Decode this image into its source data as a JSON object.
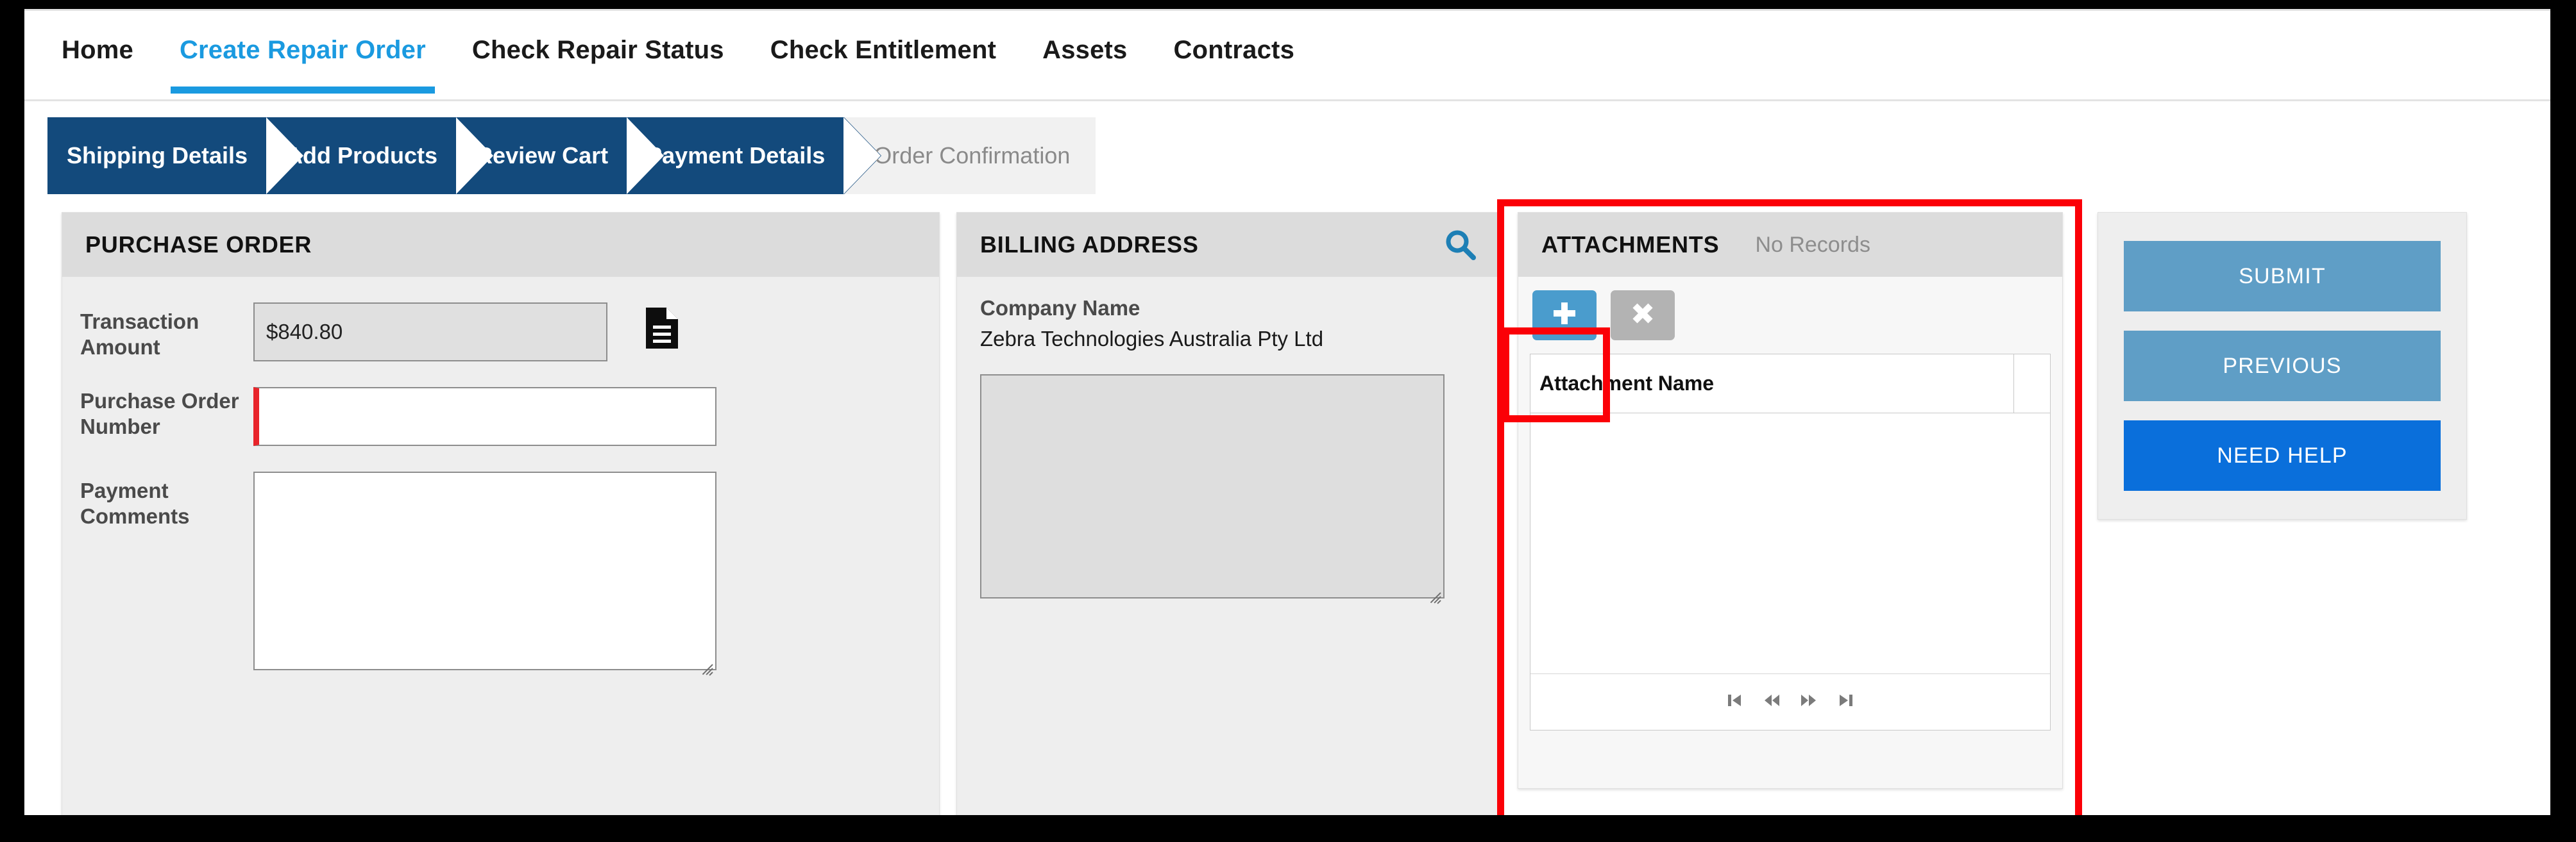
{
  "nav": {
    "items": [
      {
        "label": "Home",
        "active": false
      },
      {
        "label": "Create Repair Order",
        "active": true
      },
      {
        "label": "Check Repair Status",
        "active": false
      },
      {
        "label": "Check Entitlement",
        "active": false
      },
      {
        "label": "Assets",
        "active": false
      },
      {
        "label": "Contracts",
        "active": false
      }
    ]
  },
  "steps": [
    {
      "label": "Shipping Details",
      "state": "done"
    },
    {
      "label": "Add Products",
      "state": "done"
    },
    {
      "label": "Review Cart",
      "state": "done"
    },
    {
      "label": "Payment Details",
      "state": "current"
    },
    {
      "label": "Order Confirmation",
      "state": "upcoming"
    }
  ],
  "purchase_order": {
    "title": "PURCHASE ORDER",
    "transaction_amount_label": "Transaction Amount",
    "transaction_amount_value": "$840.80",
    "document_icon": "document-icon",
    "po_number_label": "Purchase Order Number",
    "po_number_value": "",
    "po_number_placeholder": "",
    "payment_comments_label": "Payment Comments",
    "payment_comments_value": "",
    "payment_comments_placeholder": ""
  },
  "billing_address": {
    "title": "BILLING ADDRESS",
    "search_icon": "search-icon",
    "company_name_label": "Company Name",
    "company_name_value": "Zebra Technologies Australia Pty Ltd",
    "address_value": "",
    "address_placeholder": ""
  },
  "attachments": {
    "title": "ATTACHMENTS",
    "status": "No Records",
    "add_icon": "plus-icon",
    "delete_icon": "close-icon",
    "columns": [
      "Attachment Name"
    ],
    "rows": [],
    "pager": [
      {
        "name": "first-page-button",
        "glyph": "⏮"
      },
      {
        "name": "previous-page-button",
        "glyph": "⏪"
      },
      {
        "name": "next-page-button",
        "glyph": "⏩"
      },
      {
        "name": "last-page-button",
        "glyph": "⏭"
      }
    ]
  },
  "actions": {
    "submit_label": "SUBMIT",
    "previous_label": "PREVIOUS",
    "need_help_label": "NEED HELP"
  },
  "colors": {
    "accent_blue": "#1a9ae0",
    "step_blue": "#134a7c",
    "button_light_blue": "#5f9ec6",
    "button_strong_blue": "#0a6fdb",
    "add_button_blue": "#4a9ccd",
    "required_red": "#e8242a",
    "annotation_red": "#fb0007",
    "panel_grey": "#eeeeee",
    "panel_head_grey": "#dcdcdc"
  }
}
